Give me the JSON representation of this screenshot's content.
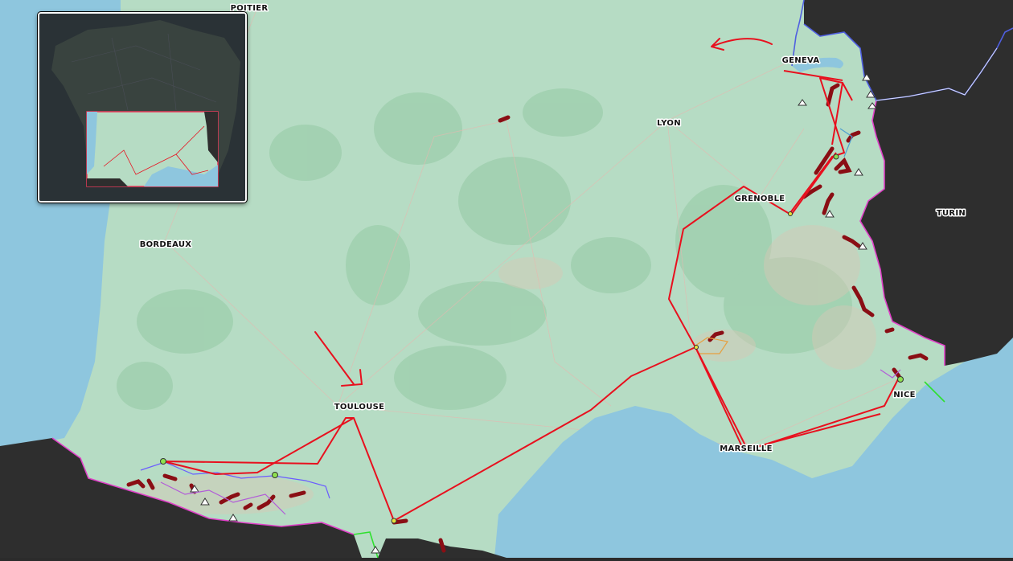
{
  "map": {
    "cities": [
      {
        "id": "poitier",
        "label": "POITIER"
      },
      {
        "id": "geneva",
        "label": "GENEVA"
      },
      {
        "id": "lyon",
        "label": "LYON"
      },
      {
        "id": "grenoble",
        "label": "GRENOBLE"
      },
      {
        "id": "turin",
        "label": "TURIN"
      },
      {
        "id": "bordeaux",
        "label": "BORDEAUX"
      },
      {
        "id": "toulouse",
        "label": "TOULOUSE"
      },
      {
        "id": "marseille",
        "label": "MARSEILLE"
      },
      {
        "id": "nice",
        "label": "NICE"
      }
    ],
    "colors": {
      "land": "#b6dcc4",
      "sea": "#8ec6de",
      "foreign": "#2e2e2e",
      "route": "#e8101e",
      "segment": "#8a0e14",
      "border_pink": "#e040c8",
      "border_blue": "#4f5fe0",
      "highlight_green": "#2ee02e"
    }
  },
  "inset": {
    "label": "overview-map",
    "colors": {
      "frame": "#f4f4f4",
      "viewport": "#e83a5a"
    }
  }
}
